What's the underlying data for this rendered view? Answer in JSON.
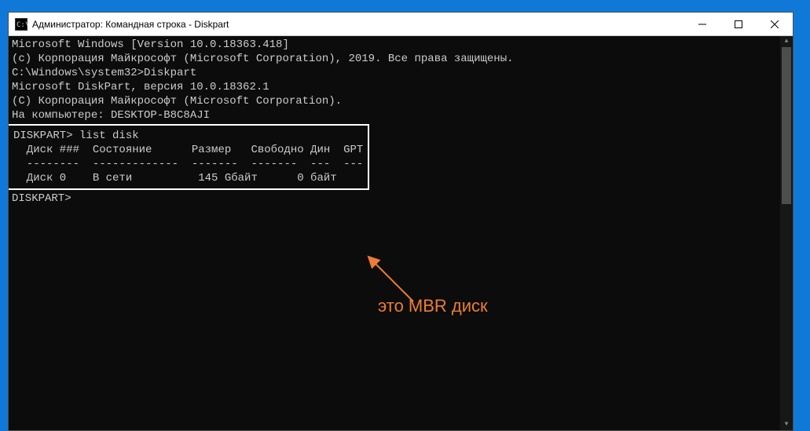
{
  "window": {
    "title": "Администратор: Командная строка - Diskpart"
  },
  "terminal": {
    "line1": "Microsoft Windows [Version 10.0.18363.418]",
    "line2": "(c) Корпорация Майкрософт (Microsoft Corporation), 2019. Все права защищены.",
    "blank1": "",
    "prompt1": "C:\\Windows\\system32>Diskpart",
    "blank2": "",
    "line3": "Microsoft DiskPart, версия 10.0.18362.1",
    "blank3": "",
    "line4": "(C) Корпорация Майкрософт (Microsoft Corporation).",
    "line5": "На компьютере: DESKTOP-B8C8AJI",
    "blank4": "",
    "box_cmd": "DISKPART> list disk",
    "box_blank1": "",
    "box_header": "  Диск ###  Состояние      Размер   Свободно Дин  GPT",
    "box_divider": "  --------  -------------  -------  -------  ---  ---",
    "box_row": "  Диск 0    В сети          145 Gбайт      0 байт",
    "prompt2": "DISKPART>"
  },
  "annotation": {
    "text": "это MBR  диск"
  }
}
